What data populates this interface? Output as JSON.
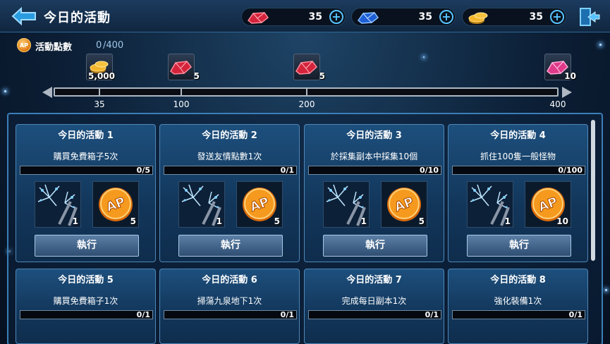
{
  "header": {
    "title": "今日的活動",
    "resources": [
      {
        "icon": "red-crystal-icon",
        "value": "35"
      },
      {
        "icon": "blue-crystal-icon",
        "value": "35"
      },
      {
        "icon": "gold-coin-icon",
        "value": "35"
      }
    ],
    "exit_icon": "exit-door-icon"
  },
  "points": {
    "label": "活動點數",
    "value": "0",
    "max": "/400",
    "progress": 0
  },
  "milestones": [
    {
      "label": "35",
      "reward_icon": "gold-coin-icon",
      "amount": "5,000"
    },
    {
      "label": "100",
      "reward_icon": "red-crystal-icon",
      "amount": "5"
    },
    {
      "label": "200",
      "reward_icon": "red-crystal-icon",
      "amount": "5"
    },
    {
      "label": "400",
      "reward_icon": "pink-crystal-icon",
      "amount": "10"
    }
  ],
  "cards": [
    {
      "title": "今日的活動 1",
      "desc": "購買免費箱子5次",
      "progress": "0/5",
      "reward1": "1",
      "reward2": "5",
      "button": "執行"
    },
    {
      "title": "今日的活動 2",
      "desc": "發送友情點數1次",
      "progress": "0/1",
      "reward1": "1",
      "reward2": "5",
      "button": "執行"
    },
    {
      "title": "今日的活動 3",
      "desc": "於採集副本中採集10個",
      "progress": "0/10",
      "reward1": "1",
      "reward2": "5",
      "button": "執行"
    },
    {
      "title": "今日的活動 4",
      "desc": "抓住100隻一般怪物",
      "progress": "0/100",
      "reward1": "1",
      "reward2": "10",
      "button": "執行"
    },
    {
      "title": "今日的活動 5",
      "desc": "購買免費箱子1次",
      "progress": "0/1"
    },
    {
      "title": "今日的活動 6",
      "desc": "掃蕩九泉地下1次",
      "progress": "0/1"
    },
    {
      "title": "今日的活動 7",
      "desc": "完成每日副本1次",
      "progress": "0/1"
    },
    {
      "title": "今日的活動 8",
      "desc": "強化裝備1次",
      "progress": "0/1"
    }
  ],
  "ap_icon_text": "AP",
  "colors": {
    "accent": "#58c4ff",
    "coin": "#f0a020",
    "panel_border": "#3b7fb8"
  }
}
